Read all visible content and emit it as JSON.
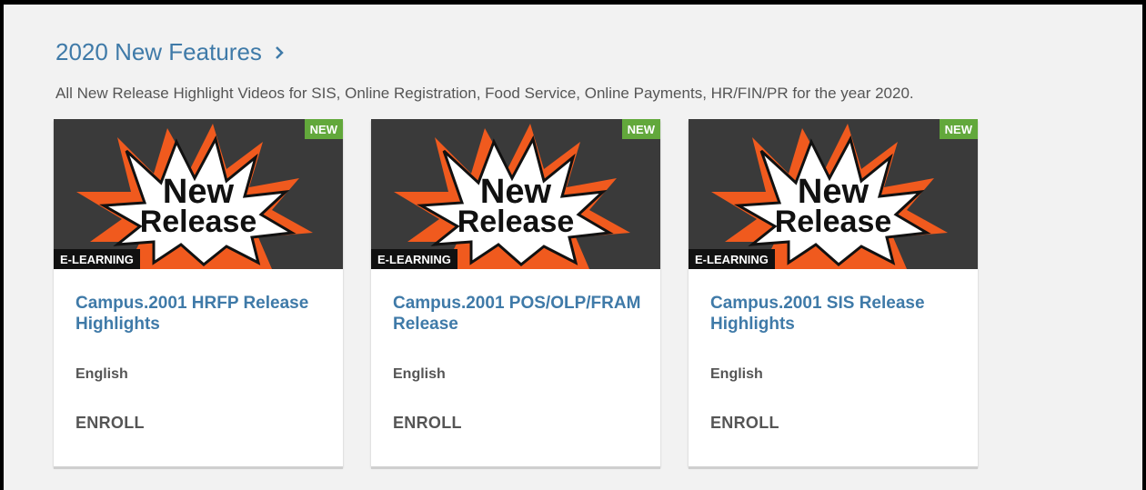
{
  "section": {
    "title": "2020 New Features",
    "description": "All New Release Highlight Videos for SIS, Online Registration, Food Service, Online Payments, HR/FIN/PR for the year 2020."
  },
  "colors": {
    "link": "#3f7aa8",
    "new_badge": "#62a83b",
    "burst": "#f05a1e"
  },
  "cards": [
    {
      "badge_new": "NEW",
      "badge_type": "E-LEARNING",
      "thumb_text_1": "New",
      "thumb_text_2": "Release",
      "title": "Campus.2001 HRFP Release Highlights",
      "language": "English",
      "action": "ENROLL"
    },
    {
      "badge_new": "NEW",
      "badge_type": "E-LEARNING",
      "thumb_text_1": "New",
      "thumb_text_2": "Release",
      "title": "Campus.2001 POS/OLP/FRAM Release",
      "language": "English",
      "action": "ENROLL"
    },
    {
      "badge_new": "NEW",
      "badge_type": "E-LEARNING",
      "thumb_text_1": "New",
      "thumb_text_2": "Release",
      "title": "Campus.2001 SIS Release Highlights",
      "language": "English",
      "action": "ENROLL"
    }
  ]
}
